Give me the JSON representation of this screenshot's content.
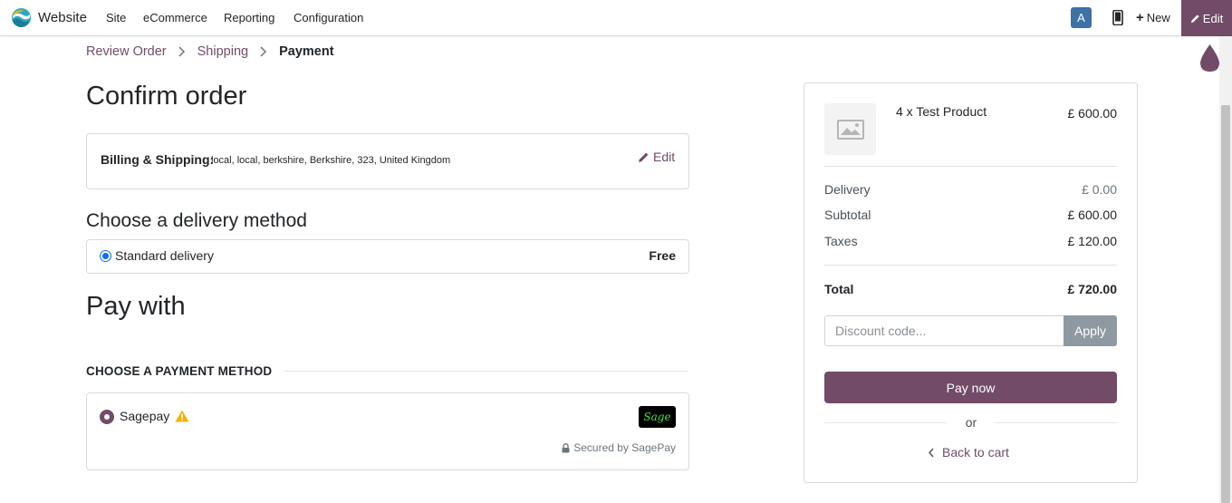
{
  "navbar": {
    "app_name": "Website",
    "menu": [
      "Site",
      "eCommerce",
      "Reporting",
      "Configuration"
    ],
    "avatar_letter": "A",
    "new_label": "New",
    "edit_label": "Edit"
  },
  "breadcrumb": [
    "Review Order",
    "Shipping",
    "Payment"
  ],
  "page_title": "Confirm order",
  "billing": {
    "label": "Billing & Shipping:",
    "address": "local, local, berkshire, Berkshire, 323, United Kingdom",
    "edit_label": "Edit"
  },
  "delivery": {
    "heading": "Choose a delivery method",
    "method_name": "Standard delivery",
    "method_price": "Free",
    "selected": true
  },
  "payment": {
    "heading": "Pay with",
    "section_label": "CHOOSE A PAYMENT METHOD",
    "method_name": "Sagepay",
    "logo_text": "Sage",
    "secured_text": "Secured by SagePay"
  },
  "summary": {
    "product_line": "4 x Test Product",
    "product_price": "£ 600.00",
    "delivery_label": "Delivery",
    "delivery_value": "£ 0.00",
    "subtotal_label": "Subtotal",
    "subtotal_value": "£ 600.00",
    "taxes_label": "Taxes",
    "taxes_value": "£ 120.00",
    "total_label": "Total",
    "total_value": "£ 720.00",
    "discount_placeholder": "Discount code...",
    "apply_label": "Apply",
    "pay_label": "Pay now",
    "or_label": "or",
    "back_label": "Back to cart"
  },
  "colors": {
    "brand": "#714b67",
    "link_blue": "#0d6efd",
    "warning": "#f0b400",
    "avatar": "#3c72a5"
  }
}
